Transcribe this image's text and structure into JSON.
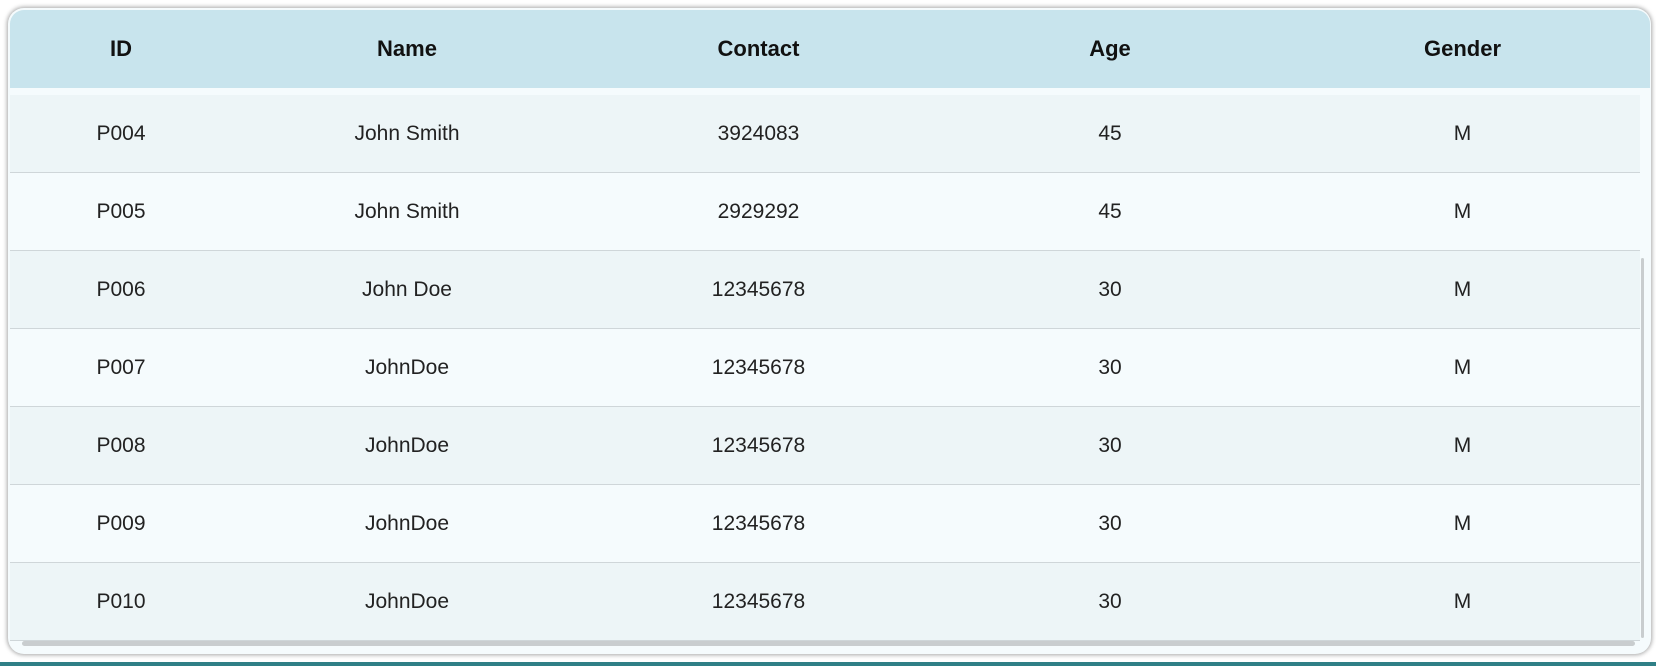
{
  "table": {
    "headers": [
      "ID",
      "Name",
      "Contact",
      "Age",
      "Gender"
    ],
    "rows": [
      [
        "P004",
        "John Smith",
        "3924083",
        "45",
        "M"
      ],
      [
        "P005",
        "John Smith",
        "2929292",
        "45",
        "M"
      ],
      [
        "P006",
        "John Doe",
        "12345678",
        "30",
        "M"
      ],
      [
        "P007",
        "JohnDoe",
        "12345678",
        "30",
        "M"
      ],
      [
        "P008",
        "JohnDoe",
        "12345678",
        "30",
        "M"
      ],
      [
        "P009",
        "JohnDoe",
        "12345678",
        "30",
        "M"
      ],
      [
        "P010",
        "JohnDoe",
        "12345678",
        "30",
        "M"
      ]
    ]
  },
  "colors": {
    "header_bg": "#c8e4ed",
    "row_odd_bg": "#edf5f7",
    "row_even_bg": "#f5fbfd",
    "accent_bottom": "#2f7f86"
  }
}
